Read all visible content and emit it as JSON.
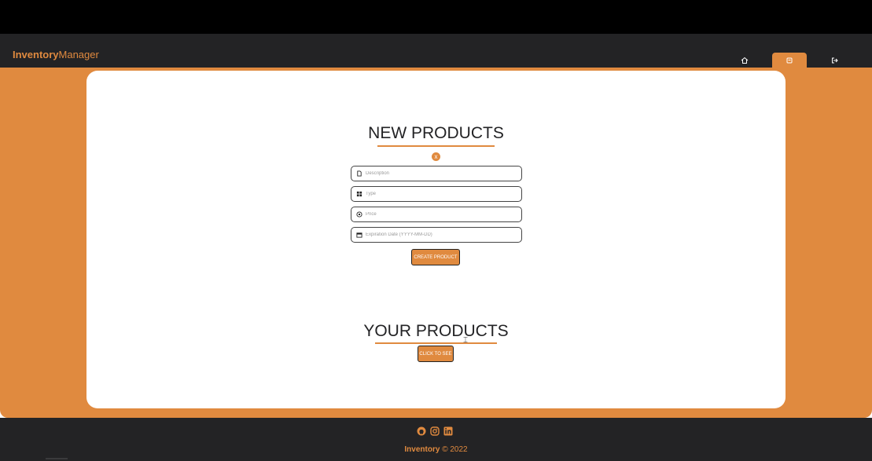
{
  "brand": {
    "bold": "Inventory",
    "light": "Manager"
  },
  "nav": {
    "items": [
      {
        "icon": "home-icon",
        "active": false
      },
      {
        "icon": "product-icon",
        "active": true
      },
      {
        "icon": "logout-icon",
        "active": false
      }
    ]
  },
  "new_section": {
    "title": "NEW PRODUCTS",
    "error_dot": "x",
    "fields": [
      {
        "icon": "document-icon",
        "placeholder": "Description",
        "value": ""
      },
      {
        "icon": "grid-icon",
        "placeholder": "Type",
        "value": ""
      },
      {
        "icon": "price-icon",
        "placeholder": "Price",
        "value": ""
      },
      {
        "icon": "calendar-icon",
        "placeholder": "Expiration Date (YYYY-MM-DD)",
        "value": ""
      }
    ],
    "create_button": "CREATE PRODUCT"
  },
  "your_section": {
    "title": "YOUR PRODUCTS",
    "see_button": "CLICK TO SEE"
  },
  "footer": {
    "social": [
      "github-icon",
      "instagram-icon",
      "linkedin-icon"
    ],
    "copyright_bold": "Inventory",
    "copyright_rest": " © 2022"
  },
  "colors": {
    "accent": "#e08a3f",
    "dark": "#232325",
    "top": "#000000"
  }
}
